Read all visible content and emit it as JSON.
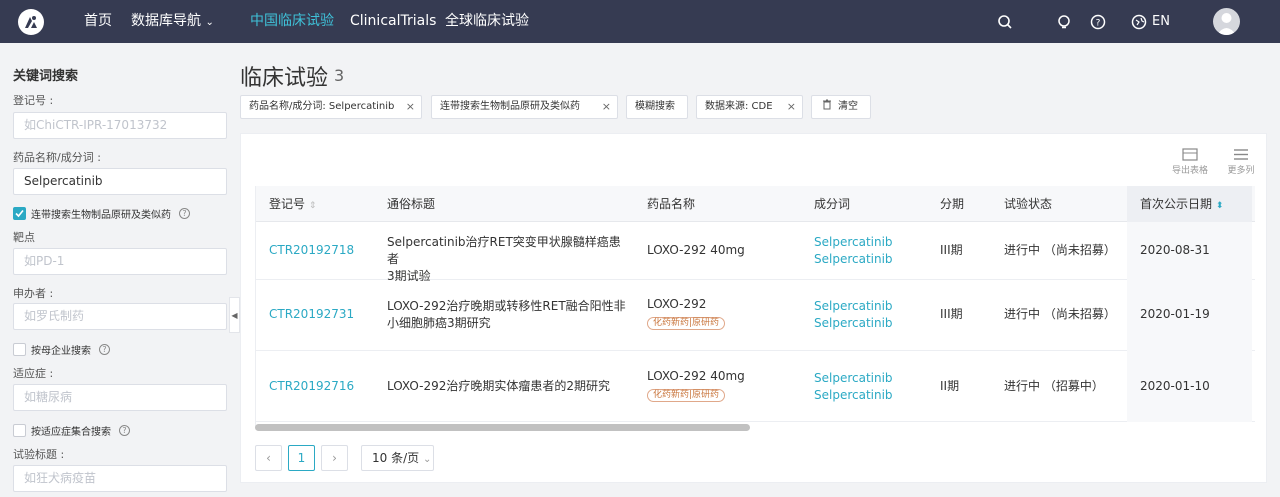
{
  "nav": {
    "home": "首页",
    "db_nav": "数据库导航",
    "china_trials": "中国临床试验",
    "clinical_trials": "ClinicalTrials",
    "global_trials": "全球临床试验",
    "lang": "EN"
  },
  "sidebar": {
    "title": "关键词搜索",
    "reg_label": "登记号 :",
    "reg_placeholder": "如ChiCTR-IPR-17013732",
    "drug_label": "药品名称/成分词 :",
    "drug_value": "Selpercatinib",
    "bio_check_label": "连带搜索生物制品原研及类似药",
    "target_label": "靶点",
    "target_placeholder": "如PD-1",
    "sponsor_label": "申办者 :",
    "sponsor_placeholder": "如罗氏制药",
    "parent_check_label": "按母企业搜索",
    "indication_label": "适应症 :",
    "indication_placeholder": "如糖尿病",
    "indication_check_label": "按适应症集合搜索",
    "trial_title_label": "试验标题 :",
    "trial_title_placeholder": "如狂犬病疫苗"
  },
  "page": {
    "title": "临床试验",
    "count": "3"
  },
  "filters": {
    "drug_chip": "药品名称/成分词: Selpercatinib",
    "bio_chip": "连带搜索生物制品原研及类似药",
    "fuzzy_chip": "模糊搜索",
    "source_chip": "数据来源: CDE",
    "clear": "清空",
    "close": "×"
  },
  "toolbar": {
    "export": "导出表格",
    "columns": "更多列"
  },
  "table": {
    "headers": [
      "登记号",
      "通俗标题",
      "药品名称",
      "成分词",
      "分期",
      "试验状态",
      "首次公示日期"
    ],
    "rows": [
      {
        "id": "CTR20192718",
        "title_line1": "Selpercatinib治疗RET突变甲状腺髓样癌患者",
        "title_line2": "3期试验",
        "drug": "LOXO-292 40mg",
        "tag": "",
        "ingredient1": "Selpercatinib",
        "ingredient2": "Selpercatinib",
        "phase": "III期",
        "status": "进行中 （尚未招募）",
        "date": "2020-08-31"
      },
      {
        "id": "CTR20192731",
        "title_line1": "LOXO-292治疗晚期或转移性RET融合阳性非",
        "title_line2": "小细胞肺癌3期研究",
        "drug": "LOXO-292",
        "tag": "化药新药|原研药",
        "ingredient1": "Selpercatinib",
        "ingredient2": "Selpercatinib",
        "phase": "III期",
        "status": "进行中 （尚未招募）",
        "date": "2020-01-19"
      },
      {
        "id": "CTR20192716",
        "title_line1": "LOXO-292治疗晚期实体瘤患者的2期研究",
        "title_line2": "",
        "drug": "LOXO-292 40mg",
        "tag": "化药新药|原研药",
        "ingredient1": "Selpercatinib",
        "ingredient2": "Selpercatinib",
        "phase": "II期",
        "status": "进行中 （招募中）",
        "date": "2020-01-10"
      }
    ]
  },
  "pagination": {
    "prev": "‹",
    "current": "1",
    "next": "›",
    "page_size": "10 条/页"
  },
  "colors": {
    "nav_bg": "#363b52",
    "accent": "#2ba9c4",
    "tag": "#c9773f"
  }
}
